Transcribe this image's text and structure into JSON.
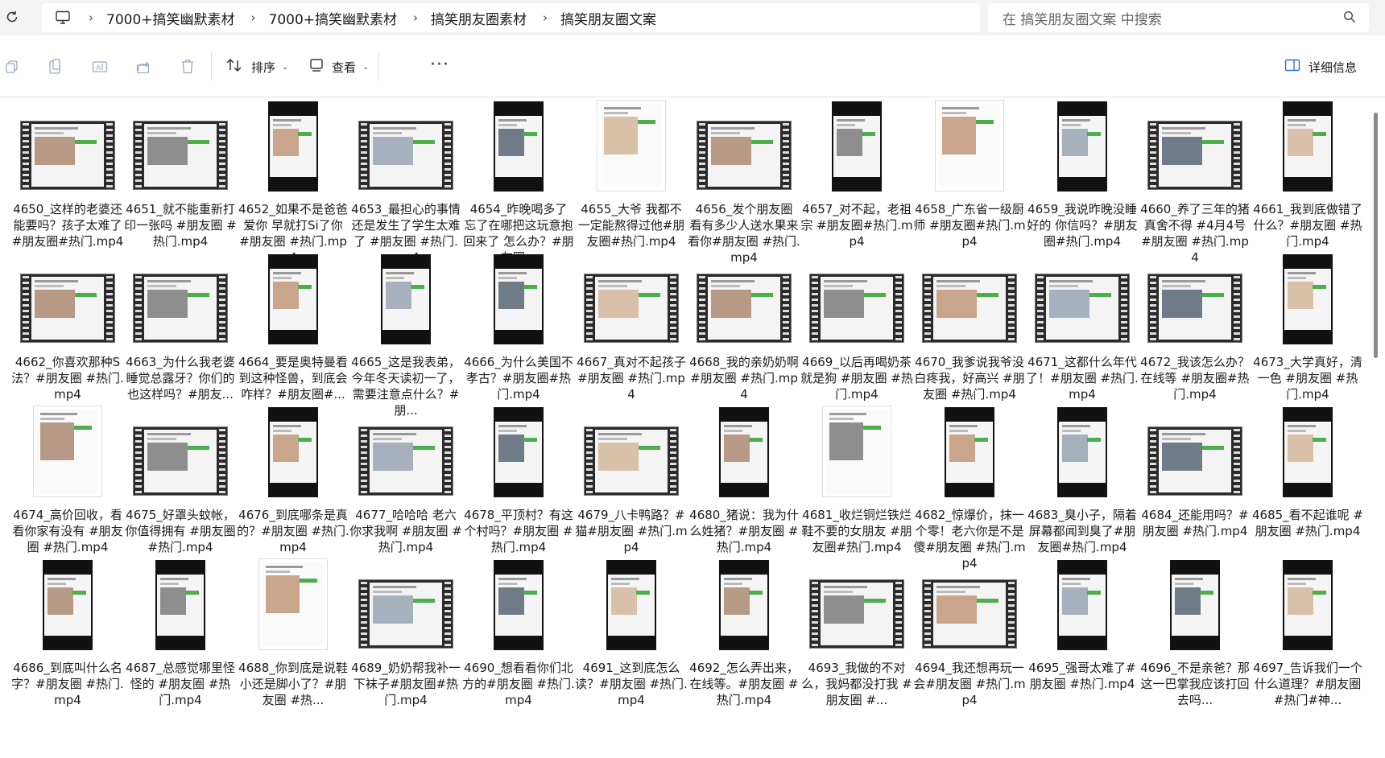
{
  "address": {
    "crumbs": [
      "7000+搞笑幽默素材",
      "7000+搞笑幽默素材",
      "搞笑朋友圈素材",
      "搞笑朋友圈文案"
    ]
  },
  "search": {
    "placeholder": "在 搞笑朋友圈文案 中搜索"
  },
  "toolbar": {
    "sort_label": "排序",
    "view_label": "查看",
    "details_label": "详细信息"
  },
  "files": [
    {
      "name": "4650_这样的老婆还能要吗？孩子太难了#朋友圈#热门.mp4",
      "thumb": "film"
    },
    {
      "name": "4651_就不能重新打印一张吗 #朋友圈 #热门.mp4",
      "thumb": "film"
    },
    {
      "name": "4652_如果不是爸爸爱你 早就打Si了你 #朋友圈 #热门.mp4",
      "thumb": "vert"
    },
    {
      "name": "4653_最担心的事情还是发生了学生太难了 #朋友圈 #热门.mp4",
      "thumb": "film"
    },
    {
      "name": "4654_昨晚喝多了 忘了在哪把这玩意抱回来了 怎么办？#朋友圈...",
      "thumb": "vert"
    },
    {
      "name": "4655_大爷 我都不一定能熬得过他#朋友圈#热门.mp4",
      "thumb": "doc"
    },
    {
      "name": "4656_发个朋友圈 看有多少人送水果来看你#朋友圈 #热门.mp4",
      "thumb": "film"
    },
    {
      "name": "4657_对不起，老祖宗 #朋友圈#热门.mp4",
      "thumb": "vert"
    },
    {
      "name": "4658_广东省一级厨师 #朋友圈#热门.mp4",
      "thumb": "doc"
    },
    {
      "name": "4659_我说昨晚没睡好的 你信吗？#朋友圈#热门.mp4",
      "thumb": "vert"
    },
    {
      "name": "4660_养了三年的猪真舍不得 #4月4号 #朋友圈 #热门.mp4",
      "thumb": "film"
    },
    {
      "name": "4661_我到底做错了什么？#朋友圈 #热门.mp4",
      "thumb": "vert"
    },
    {
      "name": "4662_你喜欢那种S法？#朋友圈 #热门.mp4",
      "thumb": "film"
    },
    {
      "name": "4663_为什么我老婆睡觉总露牙？你们的也这样吗？#朋友...",
      "thumb": "film"
    },
    {
      "name": "4664_要是奥特曼看到这种怪兽，到底会咋样？#朋友圈#...",
      "thumb": "vert"
    },
    {
      "name": "4665_这是我表弟，今年冬天读初一了，需要注意点什么？#朋...",
      "thumb": "vert"
    },
    {
      "name": "4666_为什么美国不孝古？#朋友圈#热门.mp4",
      "thumb": "vert"
    },
    {
      "name": "4667_真对不起孩子 #朋友圈 #热门.mp4",
      "thumb": "film"
    },
    {
      "name": "4668_我的亲奶奶啊 #朋友圈 #热门.mp4",
      "thumb": "film"
    },
    {
      "name": "4669_以后再喝奶茶就是狗 #朋友圈 #热门.mp4",
      "thumb": "film"
    },
    {
      "name": "4670_我爹说我爷没白疼我，好高兴 #朋友圈 #热门.mp4",
      "thumb": "film"
    },
    {
      "name": "4671_这都什么年代了！#朋友圈 #热门.mp4",
      "thumb": "film"
    },
    {
      "name": "4672_我该怎么办？在线等 #朋友圈#热门.mp4",
      "thumb": "film"
    },
    {
      "name": "4673_大学真好，清一色 #朋友圈 #热门.mp4",
      "thumb": "vert"
    },
    {
      "name": "4674_高价回收，看看你家有没有 #朋友圈 #热门.mp4",
      "thumb": "doc"
    },
    {
      "name": "4675_好罩头蚊帐，你值得拥有 #朋友圈#热门.mp4",
      "thumb": "film"
    },
    {
      "name": "4676_到底哪条是真的？#朋友圈 #热门.mp4",
      "thumb": "vert"
    },
    {
      "name": "4677_哈哈哈 老六你求我啊 #朋友圈 #热门.mp4",
      "thumb": "film"
    },
    {
      "name": "4678_平顶村？有这个村吗？#朋友圈 #热门.mp4",
      "thumb": "vert"
    },
    {
      "name": "4679_八卡鸭路？#猫#朋友圈 #热门.mp4",
      "thumb": "film"
    },
    {
      "name": "4680_猪说：我为什么姓猪？#朋友圈 #热门.mp4",
      "thumb": "vert"
    },
    {
      "name": "4681_收烂铜烂铁烂鞋不要的女朋友 #朋友圈#热门.mp4",
      "thumb": "doc"
    },
    {
      "name": "4682_惊爆价，抹一个零！老六你是不是傻#朋友圈 #热门.mp4",
      "thumb": "vert"
    },
    {
      "name": "4683_臭小子，隔着屏幕都闻到臭了#朋友圈#热门.mp4",
      "thumb": "vert"
    },
    {
      "name": "4684_还能用吗？#朋友圈 #热门.mp4",
      "thumb": "film"
    },
    {
      "name": "4685_看不起谁呢 #朋友圈 #热门.mp4",
      "thumb": "vert"
    },
    {
      "name": "4686_到底叫什么名字？#朋友圈 #热门.mp4",
      "thumb": "vert"
    },
    {
      "name": "4687_总感觉哪里怪怪的 #朋友圈 #热门.mp4",
      "thumb": "vert"
    },
    {
      "name": "4688_你到底是说鞋小还是脚小了？#朋友圈 #热...",
      "thumb": "doc"
    },
    {
      "name": "4689_奶奶帮我补一下袜子#朋友圈#热门.mp4",
      "thumb": "film"
    },
    {
      "name": "4690_想看看你们北方的#朋友圈 #热门.mp4",
      "thumb": "vert"
    },
    {
      "name": "4691_这到底怎么读？#朋友圈 #热门.mp4",
      "thumb": "vert"
    },
    {
      "name": "4692_怎么弄出来，在线等。#朋友圈 #热门.mp4",
      "thumb": "vert"
    },
    {
      "name": "4693_我做的不对么，我妈都没打我 #朋友圈 #...",
      "thumb": "film"
    },
    {
      "name": "4694_我还想再玩一会#朋友圈 #热门.mp4",
      "thumb": "film"
    },
    {
      "name": "4695_强哥太难了#朋友圈 #热门.mp4",
      "thumb": "vert"
    },
    {
      "name": "4696_不是亲爸？那这一巴掌我应该打回去吗...",
      "thumb": "vert"
    },
    {
      "name": "4697_告诉我们一个什么道理？#朋友圈#热门#神...",
      "thumb": "vert"
    }
  ]
}
